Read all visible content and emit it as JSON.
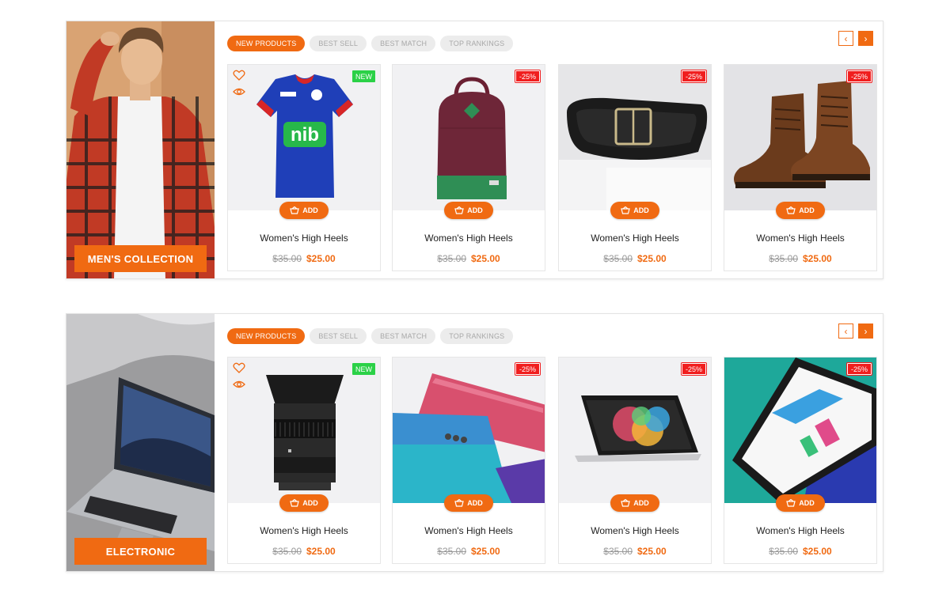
{
  "colors": {
    "accent": "#f06a12",
    "new_badge": "#2bd147",
    "sale_badge": "#f01e1e"
  },
  "tabs": [
    "NEW PRODUCTS",
    "BEST SELL",
    "BEST MATCH",
    "TOP RANKINGS"
  ],
  "add_label": "ADD",
  "sections": [
    {
      "banner_label": "MEN'S COLLECTION",
      "products": [
        {
          "badge": "NEW",
          "image": "jersey",
          "title": "Women's High Heels",
          "old_price": "$35.00",
          "price": "$25.00"
        },
        {
          "badge": "-25%",
          "image": "backpack",
          "title": "Women's High Heels",
          "old_price": "$35.00",
          "price": "$25.00"
        },
        {
          "badge": "-25%",
          "image": "belt",
          "title": "Women's High Heels",
          "old_price": "$35.00",
          "price": "$25.00"
        },
        {
          "badge": "-25%",
          "image": "boots",
          "title": "Women's High Heels",
          "old_price": "$35.00",
          "price": "$25.00"
        }
      ]
    },
    {
      "banner_label": "ELECTRONIC",
      "products": [
        {
          "badge": "NEW",
          "image": "camera-lens",
          "title": "Women's High Heels",
          "old_price": "$35.00",
          "price": "$25.00"
        },
        {
          "badge": "-25%",
          "image": "smartphones",
          "title": "Women's High Heels",
          "old_price": "$35.00",
          "price": "$25.00"
        },
        {
          "badge": "-25%",
          "image": "tablet",
          "title": "Women's High Heels",
          "old_price": "$35.00",
          "price": "$25.00"
        },
        {
          "badge": "-25%",
          "image": "laptop-screen",
          "title": "Women's High Heels",
          "old_price": "$35.00",
          "price": "$25.00"
        }
      ]
    }
  ]
}
